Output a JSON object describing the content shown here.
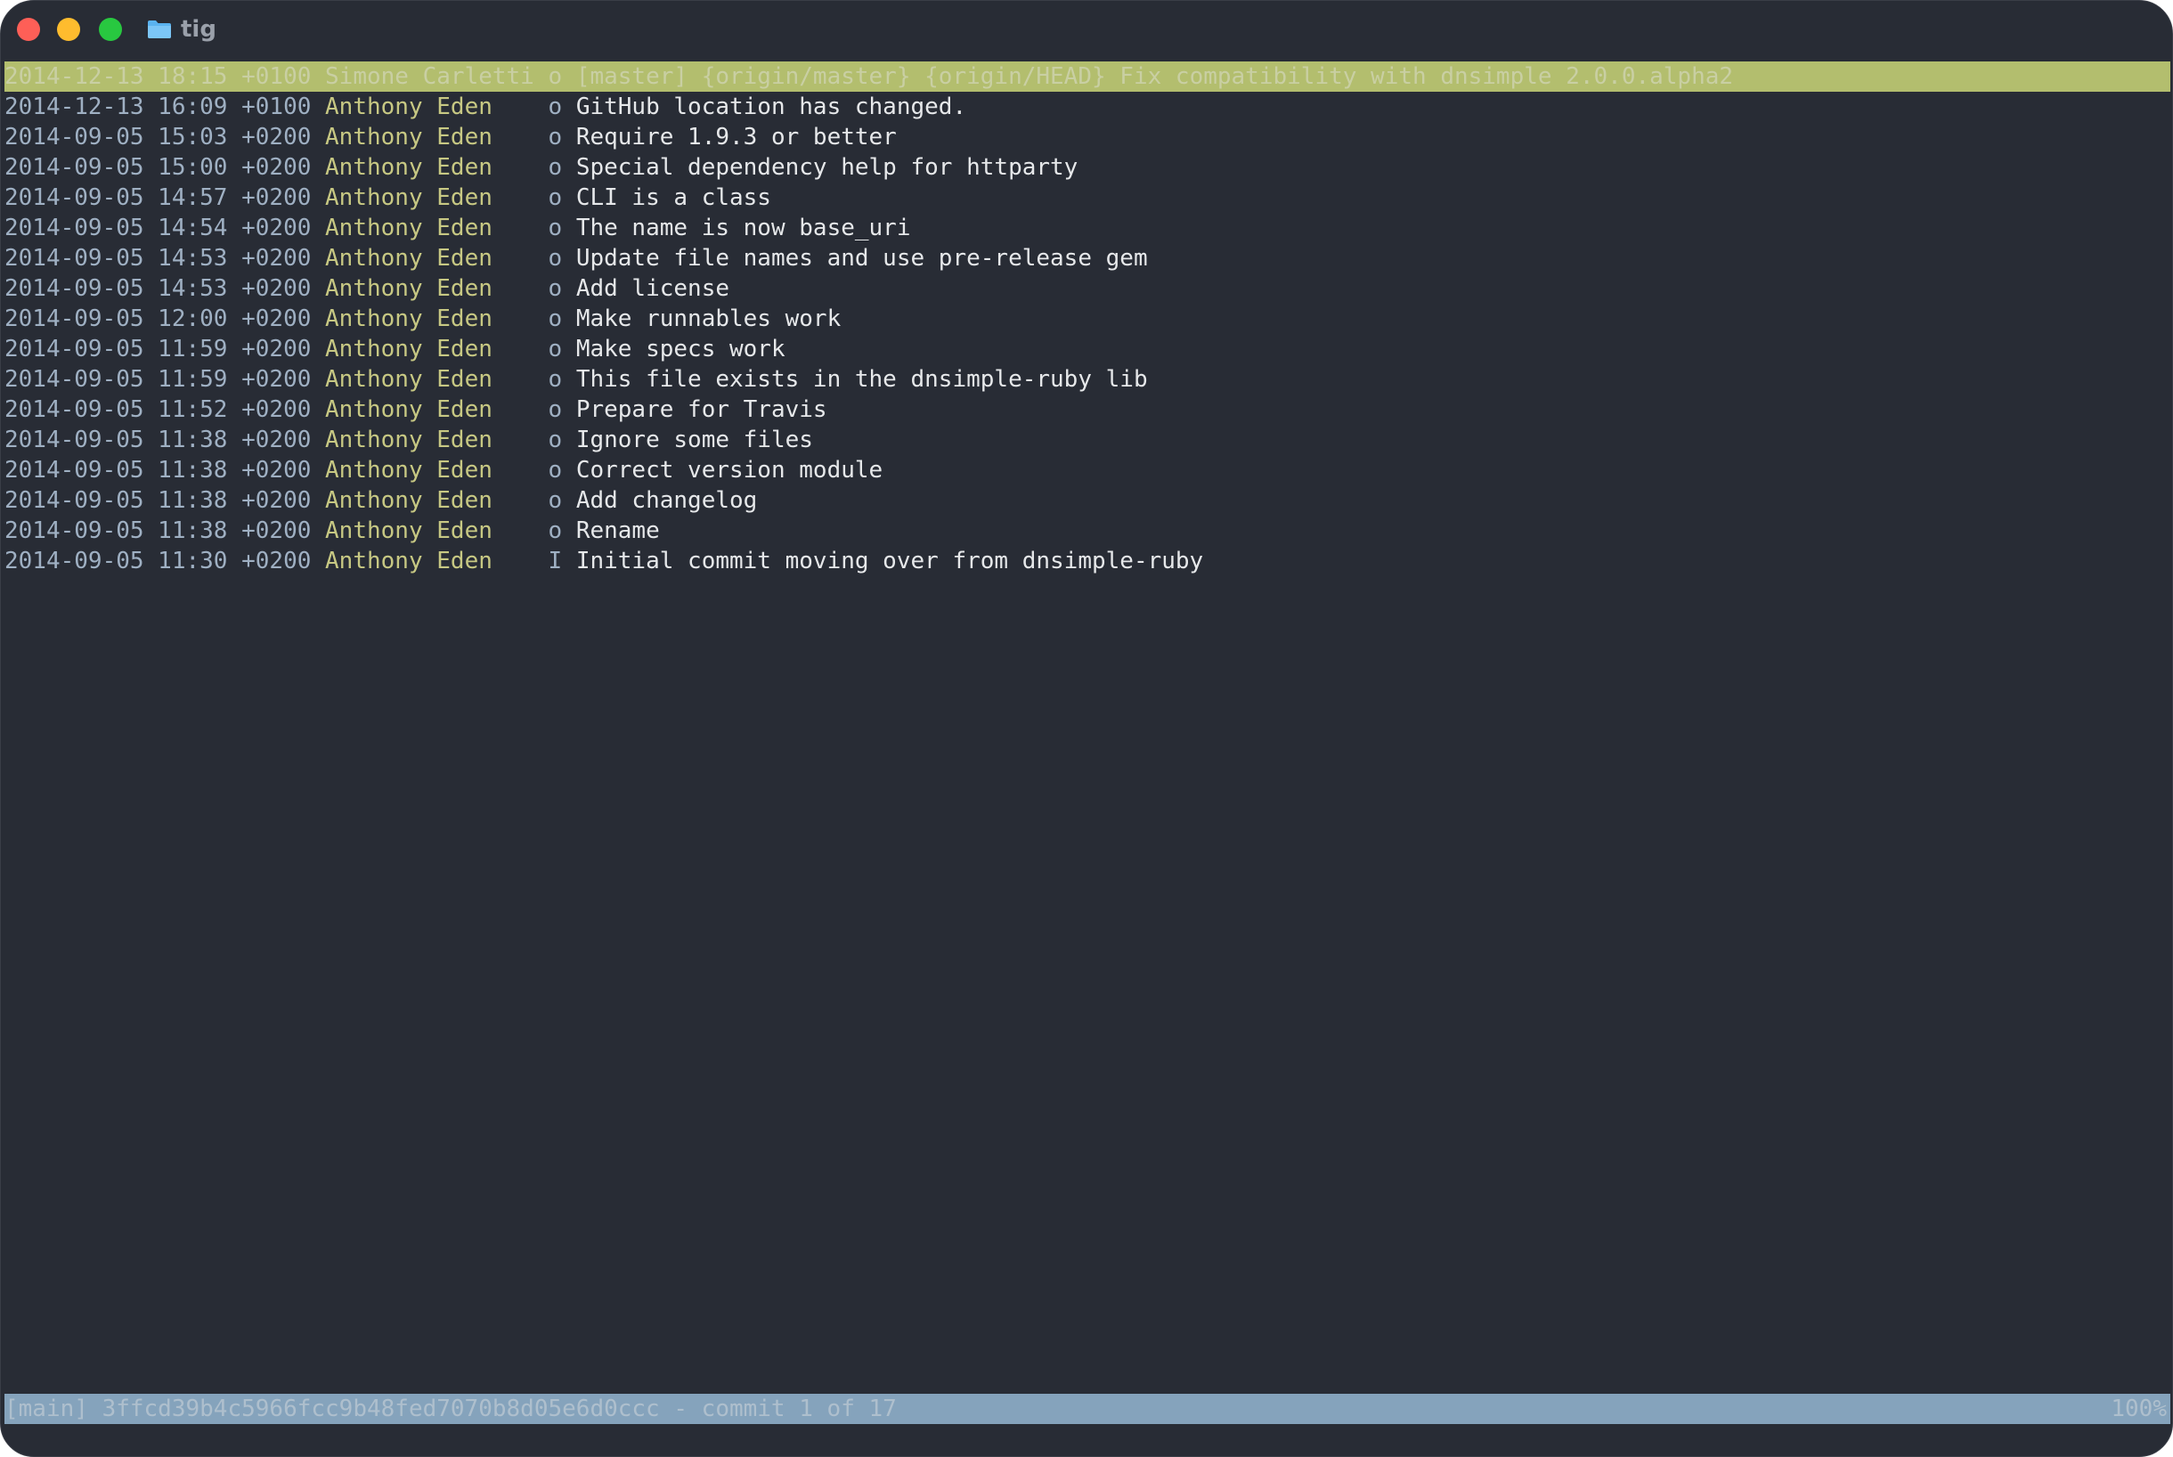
{
  "window": {
    "title": "tig",
    "colors": {
      "background": "#282c35",
      "close": "#fe5f57",
      "minimize": "#febc2e",
      "zoom": "#28c840",
      "selected_row": "#b3be6e",
      "statusbar": "#85a3bc",
      "date": "#9fb0c3",
      "author": "#c7c883",
      "message": "#e6e8ea"
    }
  },
  "commits": [
    {
      "date": "2014-12-13 18:15 +0100",
      "author": "Simone Carletti",
      "graph": "o",
      "refs": "[master] {origin/master} {origin/HEAD}",
      "message": "Fix compatibility with dnsimple 2.0.0.alpha2"
    },
    {
      "date": "2014-12-13 16:09 +0100",
      "author": "Anthony Eden",
      "graph": "o",
      "refs": "",
      "message": "GitHub location has changed."
    },
    {
      "date": "2014-09-05 15:03 +0200",
      "author": "Anthony Eden",
      "graph": "o",
      "refs": "",
      "message": "Require 1.9.3 or better"
    },
    {
      "date": "2014-09-05 15:00 +0200",
      "author": "Anthony Eden",
      "graph": "o",
      "refs": "",
      "message": "Special dependency help for httparty"
    },
    {
      "date": "2014-09-05 14:57 +0200",
      "author": "Anthony Eden",
      "graph": "o",
      "refs": "",
      "message": "CLI is a class"
    },
    {
      "date": "2014-09-05 14:54 +0200",
      "author": "Anthony Eden",
      "graph": "o",
      "refs": "",
      "message": "The name is now base_uri"
    },
    {
      "date": "2014-09-05 14:53 +0200",
      "author": "Anthony Eden",
      "graph": "o",
      "refs": "",
      "message": "Update file names and use pre-release gem"
    },
    {
      "date": "2014-09-05 14:53 +0200",
      "author": "Anthony Eden",
      "graph": "o",
      "refs": "",
      "message": "Add license"
    },
    {
      "date": "2014-09-05 12:00 +0200",
      "author": "Anthony Eden",
      "graph": "o",
      "refs": "",
      "message": "Make runnables work"
    },
    {
      "date": "2014-09-05 11:59 +0200",
      "author": "Anthony Eden",
      "graph": "o",
      "refs": "",
      "message": "Make specs work"
    },
    {
      "date": "2014-09-05 11:59 +0200",
      "author": "Anthony Eden",
      "graph": "o",
      "refs": "",
      "message": "This file exists in the dnsimple-ruby lib"
    },
    {
      "date": "2014-09-05 11:52 +0200",
      "author": "Anthony Eden",
      "graph": "o",
      "refs": "",
      "message": "Prepare for Travis"
    },
    {
      "date": "2014-09-05 11:38 +0200",
      "author": "Anthony Eden",
      "graph": "o",
      "refs": "",
      "message": "Ignore some files"
    },
    {
      "date": "2014-09-05 11:38 +0200",
      "author": "Anthony Eden",
      "graph": "o",
      "refs": "",
      "message": "Correct version module"
    },
    {
      "date": "2014-09-05 11:38 +0200",
      "author": "Anthony Eden",
      "graph": "o",
      "refs": "",
      "message": "Add changelog"
    },
    {
      "date": "2014-09-05 11:38 +0200",
      "author": "Anthony Eden",
      "graph": "o",
      "refs": "",
      "message": "Rename"
    },
    {
      "date": "2014-09-05 11:30 +0200",
      "author": "Anthony Eden",
      "graph": "I",
      "refs": "",
      "message": "Initial commit moving over from dnsimple-ruby"
    }
  ],
  "status": {
    "left": "[main] 3ffcd39b4c5966fcc9b48fed7070b8d05e6d0ccc - commit 1 of 17",
    "right": "100%"
  }
}
